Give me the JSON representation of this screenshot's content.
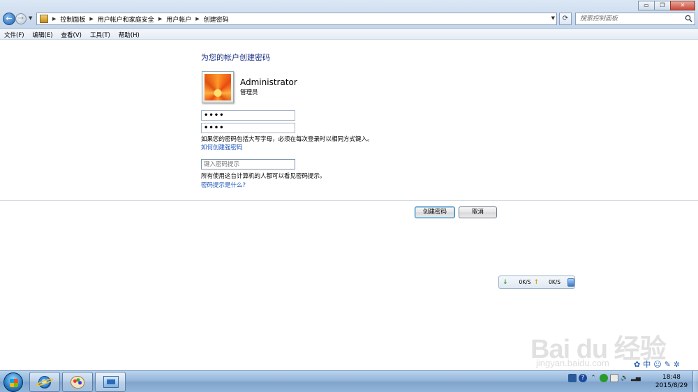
{
  "window": {
    "minimize_glyph": "▭",
    "restore_glyph": "❐",
    "close_glyph": "✕"
  },
  "address": {
    "crumbs": [
      "控制面板",
      "用户帐户和家庭安全",
      "用户帐户",
      "创建密码"
    ]
  },
  "search": {
    "placeholder": "搜索控制面板"
  },
  "menu": [
    "文件(F)",
    "编辑(E)",
    "查看(V)",
    "工具(T)",
    "帮助(H)"
  ],
  "page": {
    "heading": "为您的帐户创建密码",
    "user": {
      "name": "Administrator",
      "role": "管理员"
    },
    "password_mask": "••••",
    "confirm_mask": "••••",
    "caps_note": "如果您的密码包括大写字母，必须在每次登录时以相同方式键入。",
    "strong_pwd_link": "如何创建强密码",
    "hint_placeholder": "键入密码提示",
    "hint_note": "所有使用这台计算机的人都可以看见密码提示。",
    "hint_link": "密码提示是什么?",
    "create_button": "创建密码",
    "cancel_button": "取消"
  },
  "netspeed": {
    "down": "0K/S",
    "up": "0K/S"
  },
  "watermark": {
    "text": "Bai  du 经验",
    "sub": "jingyan.baidu.com"
  },
  "ime": [
    "✿",
    "中",
    "☺",
    "✎",
    "✲"
  ],
  "taskbar": {
    "clock_time": "18:48",
    "clock_date": "2015/8/29"
  }
}
